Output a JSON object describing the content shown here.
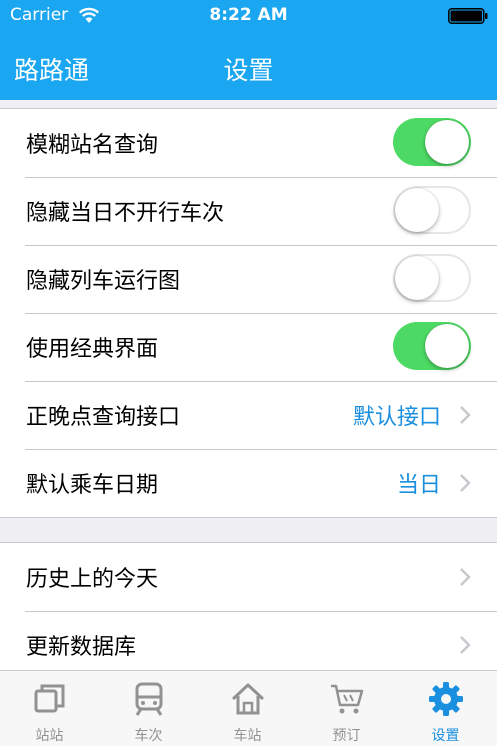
{
  "status_bar": {
    "carrier": "Carrier",
    "time": "8:22 AM"
  },
  "nav": {
    "app_name": "路路通",
    "title": "设置"
  },
  "settings_group1": [
    {
      "label": "模糊站名查询",
      "type": "toggle",
      "on": true
    },
    {
      "label": "隐藏当日不开行车次",
      "type": "toggle",
      "on": false
    },
    {
      "label": "隐藏列车运行图",
      "type": "toggle",
      "on": false
    },
    {
      "label": "使用经典界面",
      "type": "toggle",
      "on": true
    },
    {
      "label": "正晚点查询接口",
      "type": "link",
      "value": "默认接口"
    },
    {
      "label": "默认乘车日期",
      "type": "link",
      "value": "当日"
    }
  ],
  "settings_group2": [
    {
      "label": "历史上的今天",
      "type": "link"
    },
    {
      "label": "更新数据库",
      "type": "link"
    }
  ],
  "tabs": [
    {
      "label": "站站",
      "icon": "copy-icon",
      "active": false
    },
    {
      "label": "车次",
      "icon": "train-icon",
      "active": false
    },
    {
      "label": "车站",
      "icon": "home-icon",
      "active": false
    },
    {
      "label": "预订",
      "icon": "cart-icon",
      "active": false
    },
    {
      "label": "设置",
      "icon": "gear-icon",
      "active": true
    }
  ],
  "colors": {
    "accent": "#1aa6f0",
    "link": "#1a8fe0",
    "toggle_on": "#4cd964",
    "tab_inactive": "#929292"
  }
}
